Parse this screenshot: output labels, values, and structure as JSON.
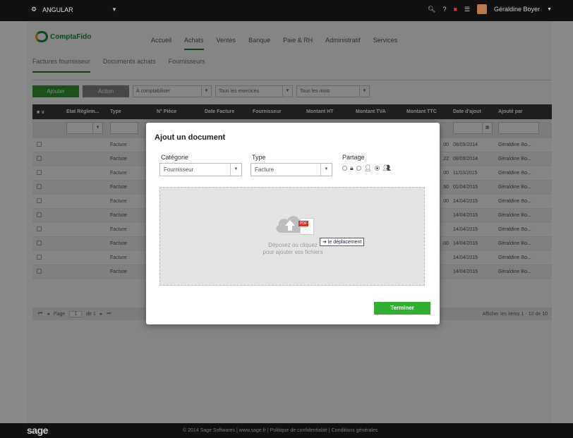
{
  "topbar": {
    "app_name": "ANGULAR",
    "user": "Géraldine Boyer"
  },
  "logo": {
    "text": "ComptaFido"
  },
  "mainnav": [
    "Accueil",
    "Achats",
    "Ventes",
    "Banque",
    "Paie & RH",
    "Administratif",
    "Services"
  ],
  "subnav": [
    "Factures fournisseur",
    "Documents achats",
    "Fournisseurs"
  ],
  "toolbar": {
    "add_label": "Ajouter",
    "action_label": "Action",
    "filter1": "À comptabiliser",
    "filter2": "Tous les exercices",
    "filter3": "Tous les mois"
  },
  "table": {
    "headers": [
      "Etat Règlem...",
      "Type",
      "N° Pièce",
      "Date Facture",
      "Fournisseur",
      "Montant HT",
      "Montant TVA",
      "Montant TTC",
      "Date d'ajout",
      "Ajouté par"
    ],
    "rows": [
      {
        "type": "Facture",
        "ttc": ".00",
        "date": "08/09/2014",
        "by": "Géraldine Bo..."
      },
      {
        "type": "Facture",
        "ttc": ".22",
        "date": "08/09/2014",
        "by": "Géraldine Bo..."
      },
      {
        "type": "Facture",
        "ttc": ".00",
        "date": "11/03/2015",
        "by": "Géraldine Bo..."
      },
      {
        "type": "Facture",
        "ttc": ".50",
        "date": "01/04/2015",
        "by": "Géraldine Bo..."
      },
      {
        "type": "Facture",
        "ttc": ".00",
        "date": "14/04/2015",
        "by": "Géraldine Bo..."
      },
      {
        "type": "Facture",
        "ttc": "",
        "date": "14/04/2015",
        "by": "Géraldine Bo..."
      },
      {
        "type": "Facture",
        "ttc": "",
        "date": "14/04/2015",
        "by": "Géraldine Bo..."
      },
      {
        "type": "Facture",
        "ttc": ".00",
        "date": "14/04/2015",
        "by": "Géraldine Bo..."
      },
      {
        "type": "Facture",
        "ttc": "",
        "date": "14/04/2015",
        "by": "Géraldine Bo..."
      },
      {
        "type": "Facture",
        "ttc": "",
        "date": "14/04/2015",
        "by": "Géraldine Bo..."
      }
    ]
  },
  "pager": {
    "page_label": "Page",
    "page": "1",
    "of": "de 1",
    "info": "Afficher les items 1 - 10 de 10"
  },
  "modal": {
    "title": "Ajout un document",
    "categorie_label": "Catégorie",
    "categorie_value": "Fournisseur",
    "type_label": "Type",
    "type_value": "Facture",
    "partage_label": "Partage",
    "dropzone_line1": "Déposez ou cliquez",
    "dropzone_line2": "pour ajouter vos fichiers",
    "pdf_tag": "PDF",
    "tooltip": "le déplacement",
    "done_label": "Terminer"
  },
  "footer": {
    "brand": "sage",
    "text": "© 2014 Sage Softwares | www.sage.fr | Politique de confidentialité | Conditions générales"
  }
}
